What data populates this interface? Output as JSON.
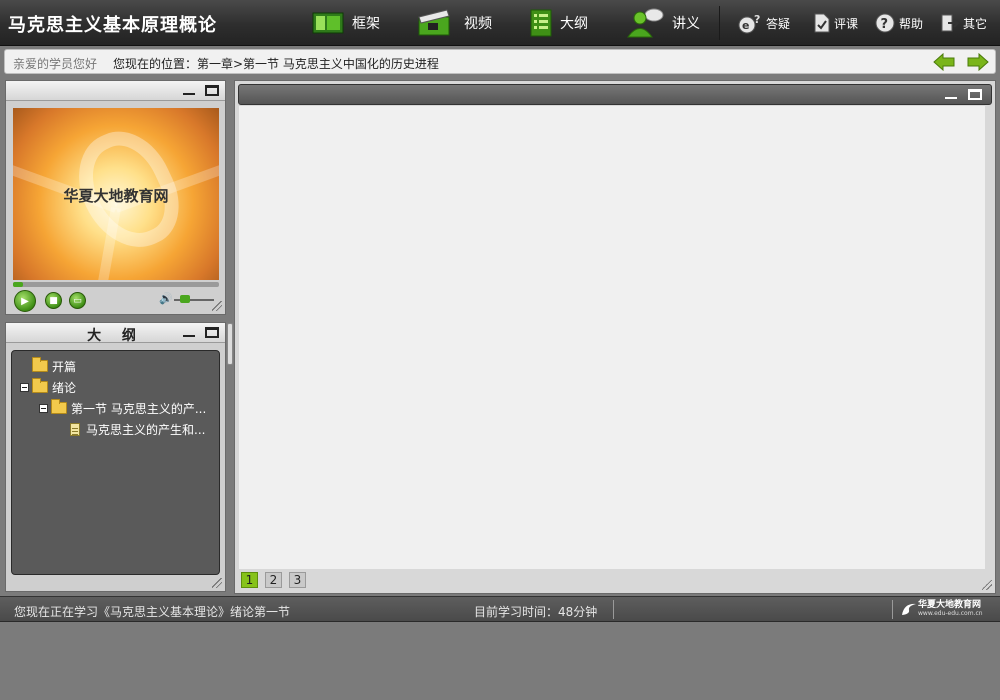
{
  "app": {
    "title": "马克思主义基本原理概论"
  },
  "nav": {
    "framework": "框架",
    "video": "视频",
    "outline": "大纲",
    "lecture": "讲义",
    "qa": "答疑",
    "review": "评课",
    "help": "帮助",
    "other": "其它"
  },
  "location": {
    "greeting": "亲爱的学员您好",
    "path": "您现在的位置：第一章>第一节  马克思主义中国化的历史进程"
  },
  "video_panel": {
    "logo_text": "华夏大地教育网",
    "progress": 0.05,
    "volume": 0.2
  },
  "outline_panel": {
    "title": "大 纲",
    "tree": [
      {
        "label": "开篇",
        "type": "folder"
      },
      {
        "label": "绪论",
        "type": "folder",
        "expanded": true
      },
      {
        "label": "第一节  马克思主义的产...",
        "type": "folder",
        "expanded": true
      },
      {
        "label": "马克思主义的产生和...",
        "type": "doc"
      }
    ]
  },
  "pagination": {
    "pages": [
      "1",
      "2",
      "3"
    ],
    "current": "1"
  },
  "status": {
    "studying": "您现在正在学习《马克思主义基本理论》绪论第一节",
    "time": "目前学习时间：48分钟",
    "brand_cn": "华夏大地教育网",
    "brand_url": "www.edu-edu.com.cn"
  },
  "colors": {
    "accent": "#86c21a",
    "topbar": "#2e2e2e",
    "background": "#7b7b7b"
  }
}
